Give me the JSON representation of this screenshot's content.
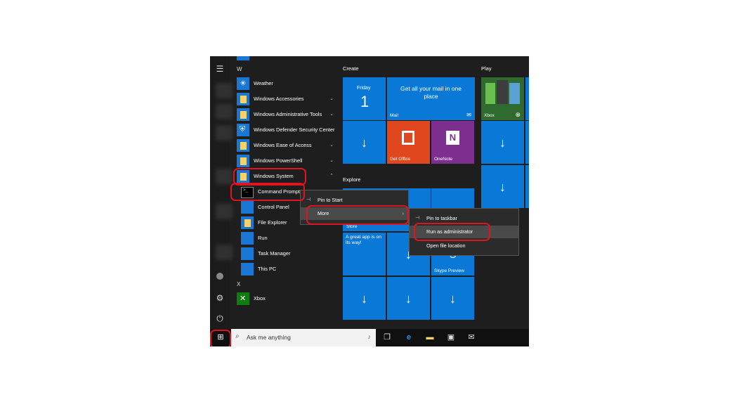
{
  "applist": {
    "letter_w": "W",
    "letter_x": "X",
    "items": [
      {
        "label": "Weather",
        "chev": ""
      },
      {
        "label": "Windows Accessories",
        "chev": "⌄"
      },
      {
        "label": "Windows Administrative Tools",
        "chev": "⌄"
      },
      {
        "label": "Windows Defender Security Center",
        "chev": ""
      },
      {
        "label": "Windows Ease of Access",
        "chev": "⌄"
      },
      {
        "label": "Windows PowerShell",
        "chev": "⌄"
      },
      {
        "label": "Windows System",
        "chev": "⌃"
      }
    ],
    "sub_items": [
      {
        "label": "Command Prompt"
      },
      {
        "label": "Control Panel"
      },
      {
        "label": "File Explorer"
      },
      {
        "label": "Run"
      },
      {
        "label": "Task Manager"
      },
      {
        "label": "This PC"
      }
    ],
    "xbox": "Xbox"
  },
  "groups": {
    "create": "Create",
    "play": "Play",
    "explore": "Explore"
  },
  "tiles": {
    "calendar_day": "Friday",
    "calendar_date": "1",
    "mail_text": "Get all your mail in one place",
    "mail_label": "Mail",
    "xbox_label": "Xbox",
    "get_office": "Get Office",
    "onenote": "OneNote",
    "store": "Store",
    "great_app": "A great app is on its way!",
    "skype": "Skype Preview"
  },
  "context_menu": {
    "pin_to_start": "Pin to Start",
    "more": "More"
  },
  "submenu": {
    "pin_to_taskbar": "Pin to taskbar",
    "run_as_admin": "Run as administrator",
    "open_file_location": "Open file location"
  },
  "taskbar": {
    "search_placeholder": "Ask me anything"
  },
  "colors": {
    "tile_blue": "#0a78d7",
    "office": "#e0471e",
    "onenote": "#7d2f8e",
    "highlight_red": "#e0141e"
  }
}
